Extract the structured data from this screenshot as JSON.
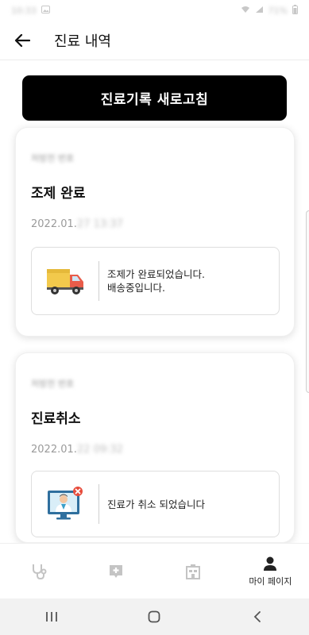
{
  "status_bar": {
    "time": "10:33",
    "battery": "71%"
  },
  "app_bar": {
    "title": "진료 내역"
  },
  "refresh_button": {
    "label": "진료기록 새로고침"
  },
  "records": [
    {
      "label": "처방전 번호",
      "status": "조제 완료",
      "date_prefix": "2022.01.",
      "date_hidden": "27 13:37",
      "icon": "delivery-truck-icon",
      "message_lines": [
        "조제가 완료되었습니다.",
        "배송중입니다."
      ]
    },
    {
      "label": "처방전 번호",
      "status": "진료취소",
      "date_prefix": "2022.01.",
      "date_hidden": "22 09:32",
      "icon": "doctor-cancel-icon",
      "message_lines": [
        "진료가 취소 되었습니다"
      ]
    }
  ],
  "bottom_nav": [
    {
      "icon": "stethoscope-icon",
      "label": ""
    },
    {
      "icon": "medical-plus-icon",
      "label": ""
    },
    {
      "icon": "hospital-icon",
      "label": ""
    },
    {
      "icon": "person-icon",
      "label": "마이 페이지"
    }
  ],
  "colors": {
    "primary": "#000000",
    "icon_gray": "#c4c4c4",
    "truck": "#f2c94c",
    "cancel": "#e74c3c"
  }
}
